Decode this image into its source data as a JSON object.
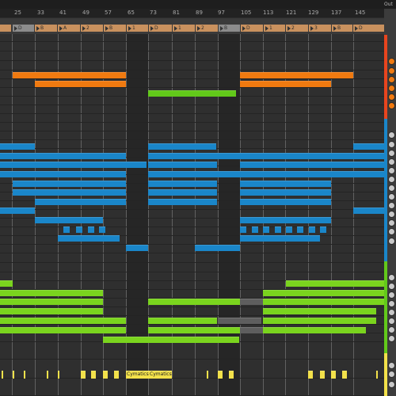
{
  "app": {
    "corner_label": "Out"
  },
  "ruler": {
    "bars": [
      "25",
      "33",
      "41",
      "49",
      "57",
      "65",
      "73",
      "81",
      "89",
      "97",
      "105",
      "113",
      "121",
      "129",
      "137",
      "145"
    ]
  },
  "locators": [
    {
      "label": "D",
      "color": "gray"
    },
    {
      "label": "B",
      "color": "orange"
    },
    {
      "label": "A",
      "color": "orange"
    },
    {
      "label": "2",
      "color": "orange"
    },
    {
      "label": "B",
      "color": "orange"
    },
    {
      "label": "1",
      "color": "orange"
    },
    {
      "label": "D",
      "color": "orange"
    },
    {
      "label": "1",
      "color": "orange"
    },
    {
      "label": "2",
      "color": "orange"
    },
    {
      "label": "B",
      "color": "gray"
    },
    {
      "label": "D",
      "color": "orange"
    },
    {
      "label": "1",
      "color": "orange"
    },
    {
      "label": "2",
      "color": "orange"
    },
    {
      "label": "3",
      "color": "orange"
    },
    {
      "label": "B",
      "color": "orange"
    },
    {
      "label": "D",
      "color": "orange"
    }
  ],
  "clip_labels": {
    "cymatics_1": "Cymatics",
    "cymatics_2": "Cymatics"
  },
  "colors": {
    "orange": "#f07a10",
    "blue": "#1a86c9",
    "green": "#62c91a",
    "yellow": "#f3e14a",
    "group_red": "#e8451e"
  }
}
